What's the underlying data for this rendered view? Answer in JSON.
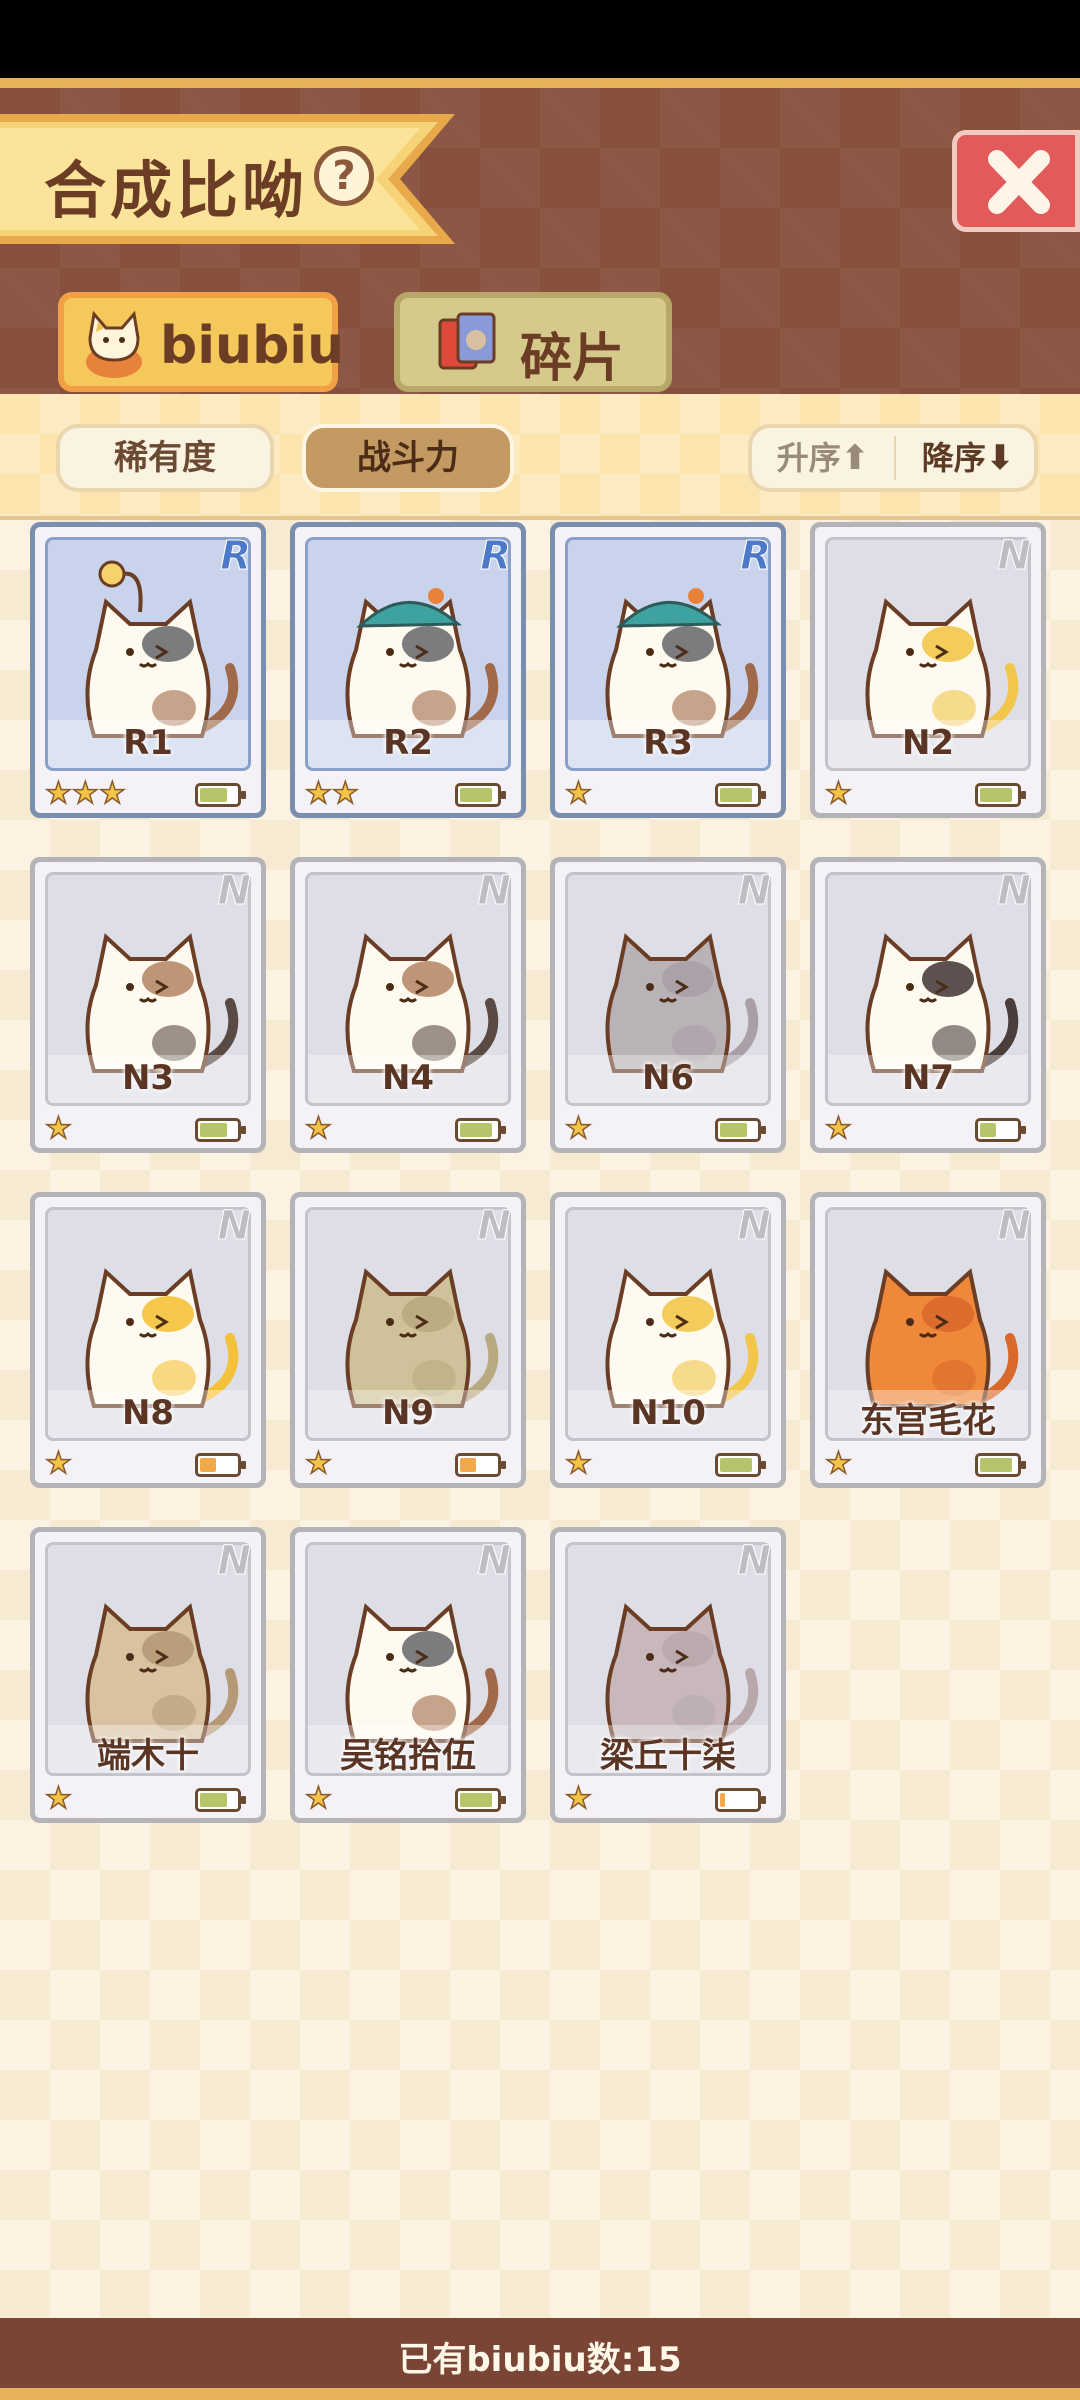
{
  "header": {
    "title": "合成比呦",
    "help_symbol": "?",
    "close_icon": "close-x-icon"
  },
  "tabs": [
    {
      "label": "biubiu",
      "icon": "cat-avatar-icon",
      "active": true
    },
    {
      "label": "碎片",
      "icon": "fragment-card-icon",
      "active": false
    }
  ],
  "filters": {
    "rarity_label": "稀有度",
    "power_label": "战斗力",
    "power_selected": true,
    "asc_label": "升序",
    "desc_label": "降序",
    "asc_icon": "arrow-up-icon",
    "desc_icon": "arrow-down-icon"
  },
  "cards": [
    {
      "name": "R1",
      "rarity": "R",
      "stars": 3,
      "battery": 0.75,
      "battery_color": "#b7c46a",
      "cat": "calico-grey",
      "accessory": "lamp"
    },
    {
      "name": "R2",
      "rarity": "R",
      "stars": 2,
      "battery": 0.9,
      "battery_color": "#b7c46a",
      "cat": "calico-grey",
      "accessory": "teal-hat"
    },
    {
      "name": "R3",
      "rarity": "R",
      "stars": 1,
      "battery": 0.9,
      "battery_color": "#b7c46a",
      "cat": "calico-grey",
      "accessory": "teal-hat"
    },
    {
      "name": "N2",
      "rarity": "N",
      "stars": 1,
      "battery": 0.9,
      "battery_color": "#b7c46a",
      "cat": "white-yellow"
    },
    {
      "name": "N3",
      "rarity": "N",
      "stars": 1,
      "battery": 0.75,
      "battery_color": "#b7c46a",
      "cat": "tricolor"
    },
    {
      "name": "N4",
      "rarity": "N",
      "stars": 1,
      "battery": 0.9,
      "battery_color": "#b7c46a",
      "cat": "tricolor"
    },
    {
      "name": "N6",
      "rarity": "N",
      "stars": 1,
      "battery": 0.75,
      "battery_color": "#b7c46a",
      "cat": "grey"
    },
    {
      "name": "N7",
      "rarity": "N",
      "stars": 1,
      "battery": 0.45,
      "battery_color": "#b7c46a",
      "cat": "black-white"
    },
    {
      "name": "N8",
      "rarity": "N",
      "stars": 1,
      "battery": 0.45,
      "battery_color": "#f2a94a",
      "cat": "yellow-white"
    },
    {
      "name": "N9",
      "rarity": "N",
      "stars": 1,
      "battery": 0.45,
      "battery_color": "#f2a94a",
      "cat": "olive"
    },
    {
      "name": "N10",
      "rarity": "N",
      "stars": 1,
      "battery": 0.9,
      "battery_color": "#b7c46a",
      "cat": "white-yellow"
    },
    {
      "name": "东宫毛花",
      "rarity": "N",
      "stars": 1,
      "battery": 0.9,
      "battery_color": "#b7c46a",
      "cat": "orange"
    },
    {
      "name": "端木十",
      "rarity": "N",
      "stars": 1,
      "battery": 0.75,
      "battery_color": "#b7c46a",
      "cat": "tabby"
    },
    {
      "name": "吴铭拾伍",
      "rarity": "N",
      "stars": 1,
      "battery": 0.9,
      "battery_color": "#b7c46a",
      "cat": "calico-grey"
    },
    {
      "name": "梁丘十柒",
      "rarity": "N",
      "stars": 1,
      "battery": 0.15,
      "battery_color": "#f2a94a",
      "cat": "mauve"
    }
  ],
  "footer": {
    "count_text": "已有biubiu数:15"
  },
  "colors": {
    "header_brown": "#87503d",
    "banner_gold": "#f4c85a",
    "close_red": "#e25a5a",
    "rare_blue": "#4d79c9"
  }
}
